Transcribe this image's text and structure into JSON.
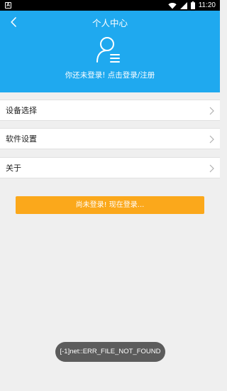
{
  "status_bar": {
    "left_icon": "A",
    "time": "11:20",
    "icons": [
      "wifi-icon",
      "signal-icon",
      "battery-icon"
    ]
  },
  "header": {
    "title": "个人中心",
    "login_prompt": "你还未登录! 点击登录/注册",
    "background_color": "#1fa9ef"
  },
  "menu": {
    "items": [
      {
        "label": "设备选择"
      },
      {
        "label": "软件设置"
      },
      {
        "label": "关于"
      }
    ]
  },
  "login_button": {
    "label": "尚未登录! 现在登录...",
    "color": "#fba81b"
  },
  "toast": {
    "message": "[-1]net::ERR_FILE_NOT_FOUND"
  }
}
